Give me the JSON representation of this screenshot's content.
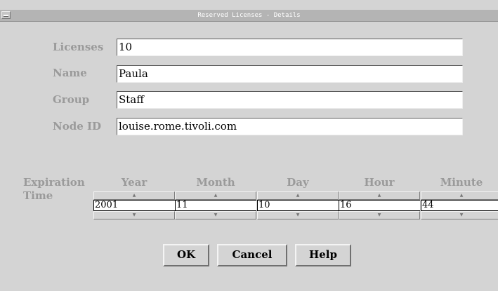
{
  "window": {
    "title": "Reserved Licenses - Details"
  },
  "form": {
    "licenses_label": "Licenses",
    "licenses_value": "10",
    "name_label": "Name",
    "name_value": "Paula",
    "group_label": "Group",
    "group_value": "Staff",
    "nodeid_label": "Node ID",
    "nodeid_value": "louise.rome.tivoli.com"
  },
  "expiration": {
    "label_line1": "Expiration",
    "label_line2": "Time",
    "columns": [
      {
        "label": "Year",
        "value": "2001"
      },
      {
        "label": "Month",
        "value": "11"
      },
      {
        "label": "Day",
        "value": "10"
      },
      {
        "label": "Hour",
        "value": "16"
      },
      {
        "label": "Minute",
        "value": "44"
      }
    ],
    "up_arrow": "▲",
    "down_arrow": "▼"
  },
  "buttons": {
    "ok": "OK",
    "cancel": "Cancel",
    "help": "Help"
  }
}
